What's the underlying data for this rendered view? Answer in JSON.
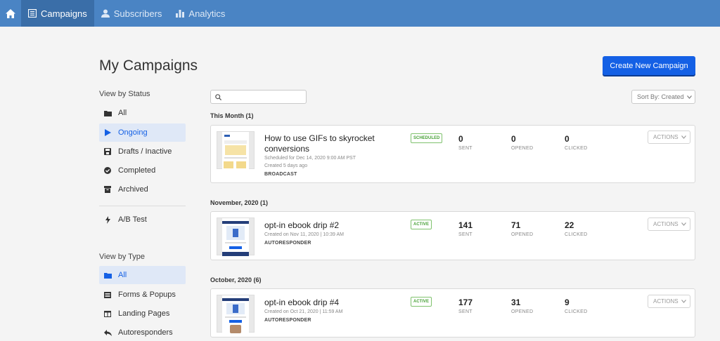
{
  "nav": {
    "items": [
      {
        "label": "Campaigns"
      },
      {
        "label": "Subscribers"
      },
      {
        "label": "Analytics"
      }
    ]
  },
  "header": {
    "title": "My Campaigns",
    "create_button": "Create New Campaign"
  },
  "sidebar": {
    "status_heading": "View by Status",
    "status_items": [
      {
        "label": "All",
        "icon": "folder-icon"
      },
      {
        "label": "Ongoing",
        "icon": "play-icon",
        "selected": true
      },
      {
        "label": "Drafts / Inactive",
        "icon": "save-icon"
      },
      {
        "label": "Completed",
        "icon": "check-circle-icon"
      },
      {
        "label": "Archived",
        "icon": "archive-icon"
      }
    ],
    "ab_test": {
      "label": "A/B Test",
      "icon": "bolt-icon"
    },
    "type_heading": "View by Type",
    "type_items": [
      {
        "label": "All",
        "icon": "folder-icon",
        "selected": true
      },
      {
        "label": "Forms & Popups",
        "icon": "form-icon"
      },
      {
        "label": "Landing Pages",
        "icon": "landing-page-icon"
      },
      {
        "label": "Autoresponders",
        "icon": "reply-icon"
      }
    ]
  },
  "toolbar": {
    "search_value": "",
    "sort_label": "Sort By: Created"
  },
  "groups": [
    {
      "heading": "This Month (1)",
      "campaigns": [
        {
          "title": "How to use GIFs to skyrocket conversions",
          "meta": [
            "Scheduled for Dec 14, 2020 9:00 AM PST",
            "Created 5 days ago"
          ],
          "type": "BROADCAST",
          "badge": "SCHEDULED",
          "sent": "0",
          "opened": "0",
          "clicked": "0"
        }
      ]
    },
    {
      "heading": "November, 2020 (1)",
      "campaigns": [
        {
          "title": "opt-in ebook drip #2",
          "meta": [
            "Created on Nov 11, 2020 | 10:39 AM"
          ],
          "type": "AUTORESPONDER",
          "badge": "ACTIVE",
          "sent": "141",
          "opened": "71",
          "clicked": "22"
        }
      ]
    },
    {
      "heading": "October, 2020 (6)",
      "campaigns": [
        {
          "title": "opt-in ebook drip #4",
          "meta": [
            "Created on Oct 21, 2020 | 11:59 AM"
          ],
          "type": "AUTORESPONDER",
          "badge": "ACTIVE",
          "sent": "177",
          "opened": "31",
          "clicked": "9"
        }
      ]
    }
  ],
  "stat_labels": {
    "sent": "SENT",
    "opened": "OPENED",
    "clicked": "CLICKED"
  },
  "actions_label": "ACTIONS",
  "colors": {
    "nav": "#4a84c4",
    "nav_active": "#3a6ea8",
    "primary": "#1460e5",
    "badge_green": "#4aa23a",
    "selected_bg": "#dfe8f7"
  }
}
